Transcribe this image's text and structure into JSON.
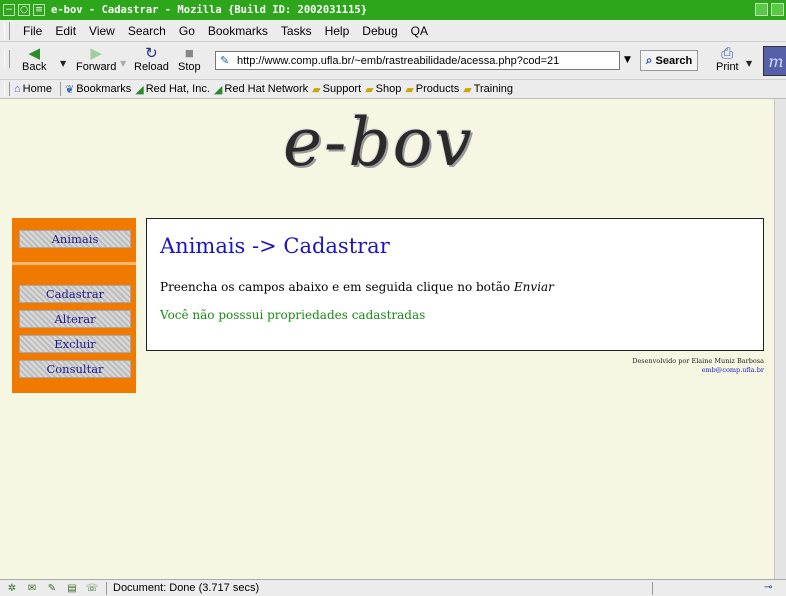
{
  "window": {
    "title": "e-bov - Cadastrar - Mozilla {Build ID: 2002031115}"
  },
  "menu": [
    "File",
    "Edit",
    "View",
    "Search",
    "Go",
    "Bookmarks",
    "Tasks",
    "Help",
    "Debug",
    "QA"
  ],
  "toolbar": {
    "back": "Back",
    "forward": "Forward",
    "reload": "Reload",
    "stop": "Stop",
    "url": "http://www.comp.ufla.br/~emb/rastreabilidade/acessa.php?cod=21",
    "search": "Search",
    "print": "Print"
  },
  "personal_toolbar": [
    "Home",
    "Bookmarks",
    "Red Hat, Inc.",
    "Red Hat Network",
    "Support",
    "Shop",
    "Products",
    "Training"
  ],
  "page": {
    "logo_text": "e-bov",
    "sidebar": {
      "section": "Animais",
      "items": [
        "Cadastrar",
        "Alterar",
        "Excluir",
        "Consultar"
      ]
    },
    "panel": {
      "title": "Animais -> Cadastrar",
      "instruction": "Preencha os campos abaixo e em seguida clique no botão",
      "instruction_action": "Enviar",
      "message": "Você não posssui propriedades cadastradas"
    },
    "credit": {
      "line1": "Desenvolvido por Elaine Muniz Barbosa",
      "email": "emb@comp.ufla.br"
    }
  },
  "status": {
    "text": "Document: Done (3.717 secs)"
  },
  "colors": {
    "titlebar": "#2da61b",
    "sidebar": "#f07a00",
    "page_bg": "#f5f7e3",
    "heading": "#1a14c8",
    "message": "#1a8a16"
  }
}
